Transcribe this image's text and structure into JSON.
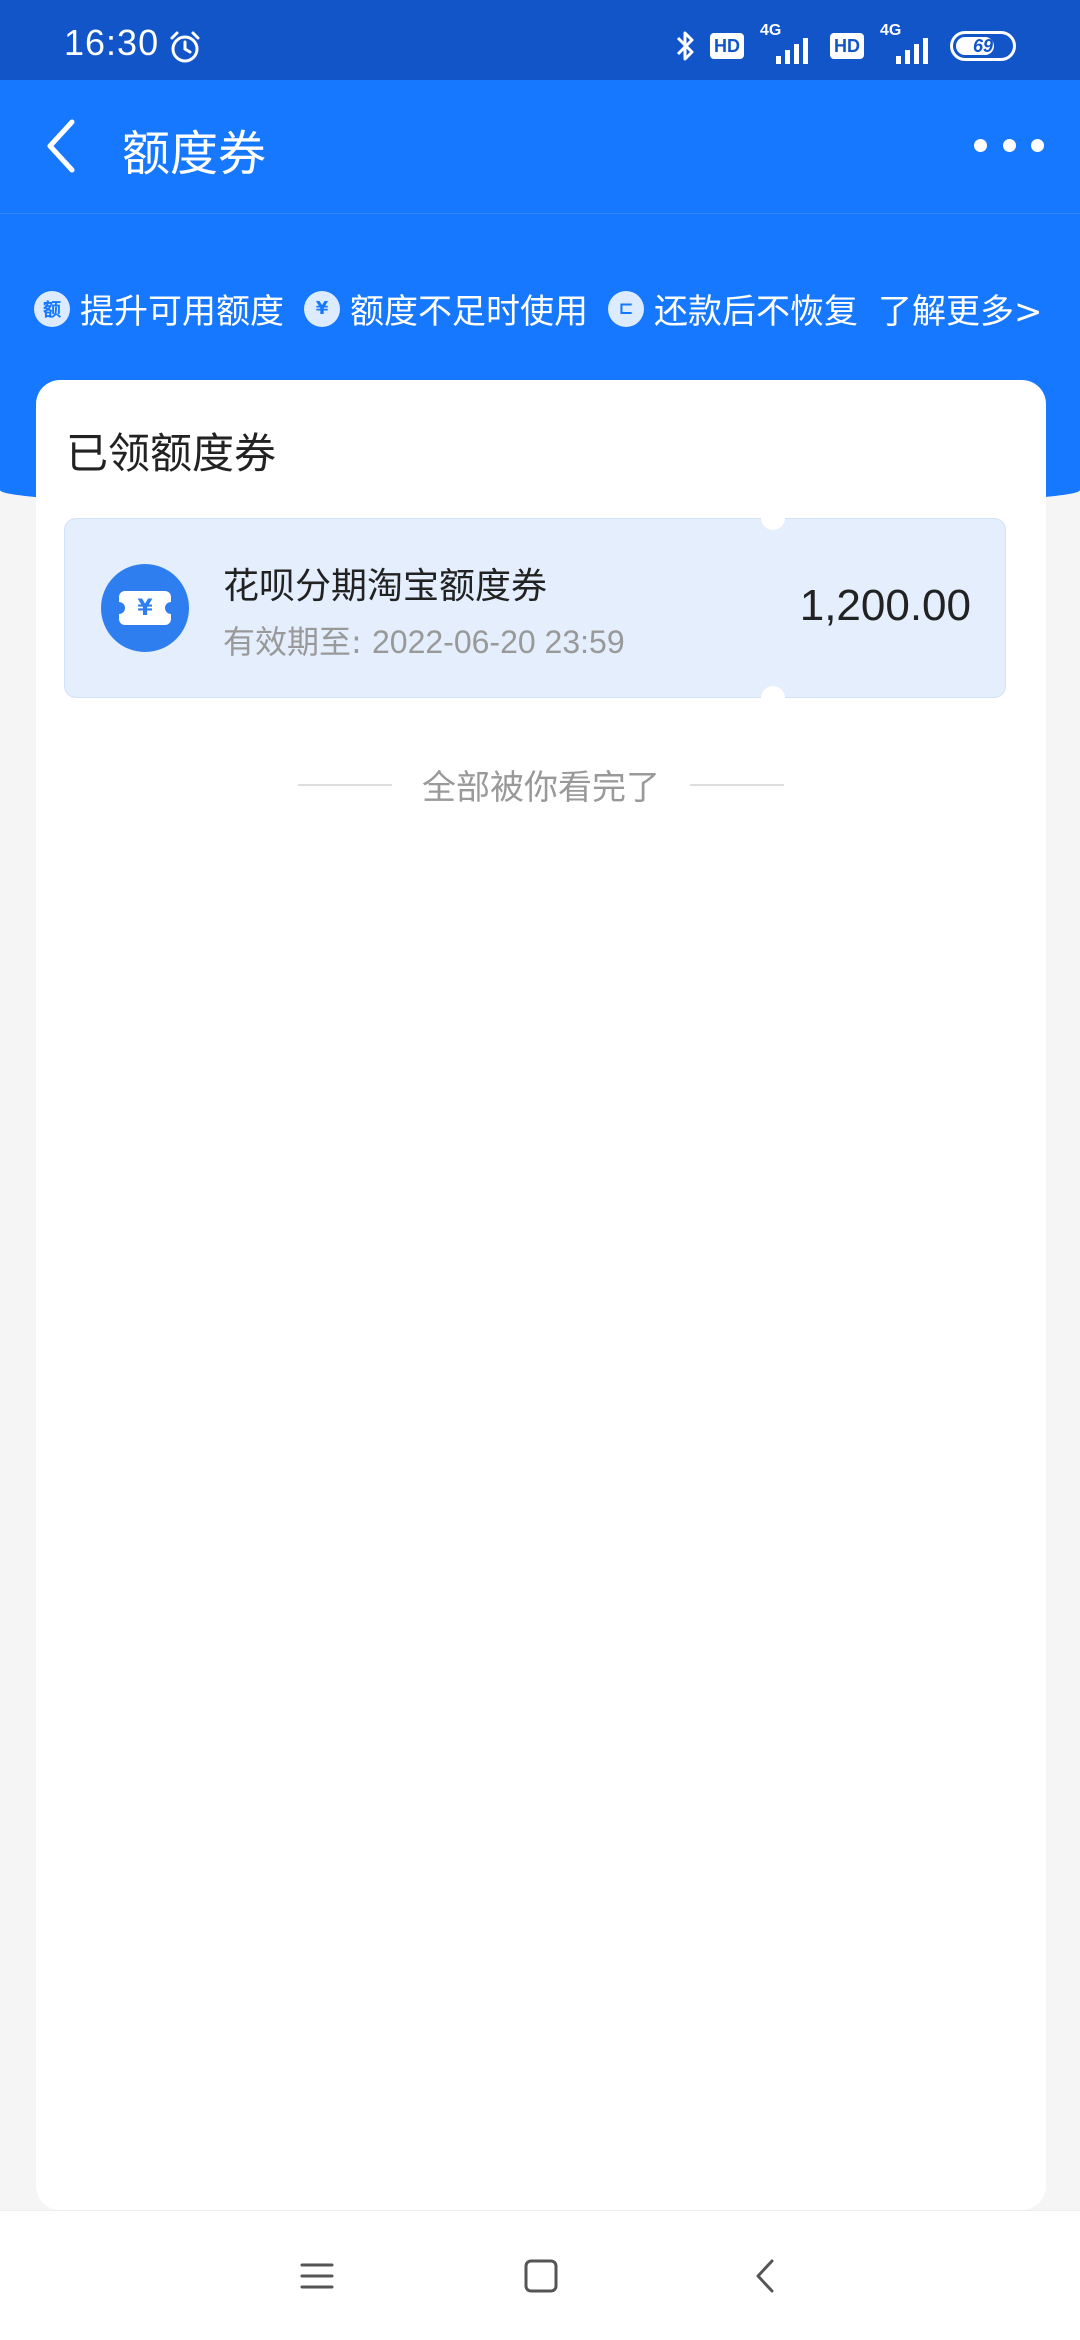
{
  "status_bar": {
    "time": "16:30",
    "hd_label": "HD",
    "network_label": "4G",
    "battery": "69"
  },
  "header": {
    "title": "额度券"
  },
  "features": [
    {
      "icon": "额",
      "label": "提升可用额度"
    },
    {
      "icon": "¥",
      "label": "额度不足时使用"
    },
    {
      "icon": "⊏",
      "label": "还款后不恢复"
    }
  ],
  "learn_more": "了解更多>",
  "section_title": "已领额度券",
  "voucher": {
    "name": "花呗分期淘宝额度券",
    "expiry_label": "有效期至: ",
    "expiry_value": "2022-06-20 23:59",
    "amount": "1,200.00",
    "icon_symbol": "¥"
  },
  "end_text": "全部被你看完了",
  "colors": {
    "primary_blue": "#1677ff",
    "status_bar": "#1155c9",
    "voucher_bg": "#e4eefc"
  }
}
